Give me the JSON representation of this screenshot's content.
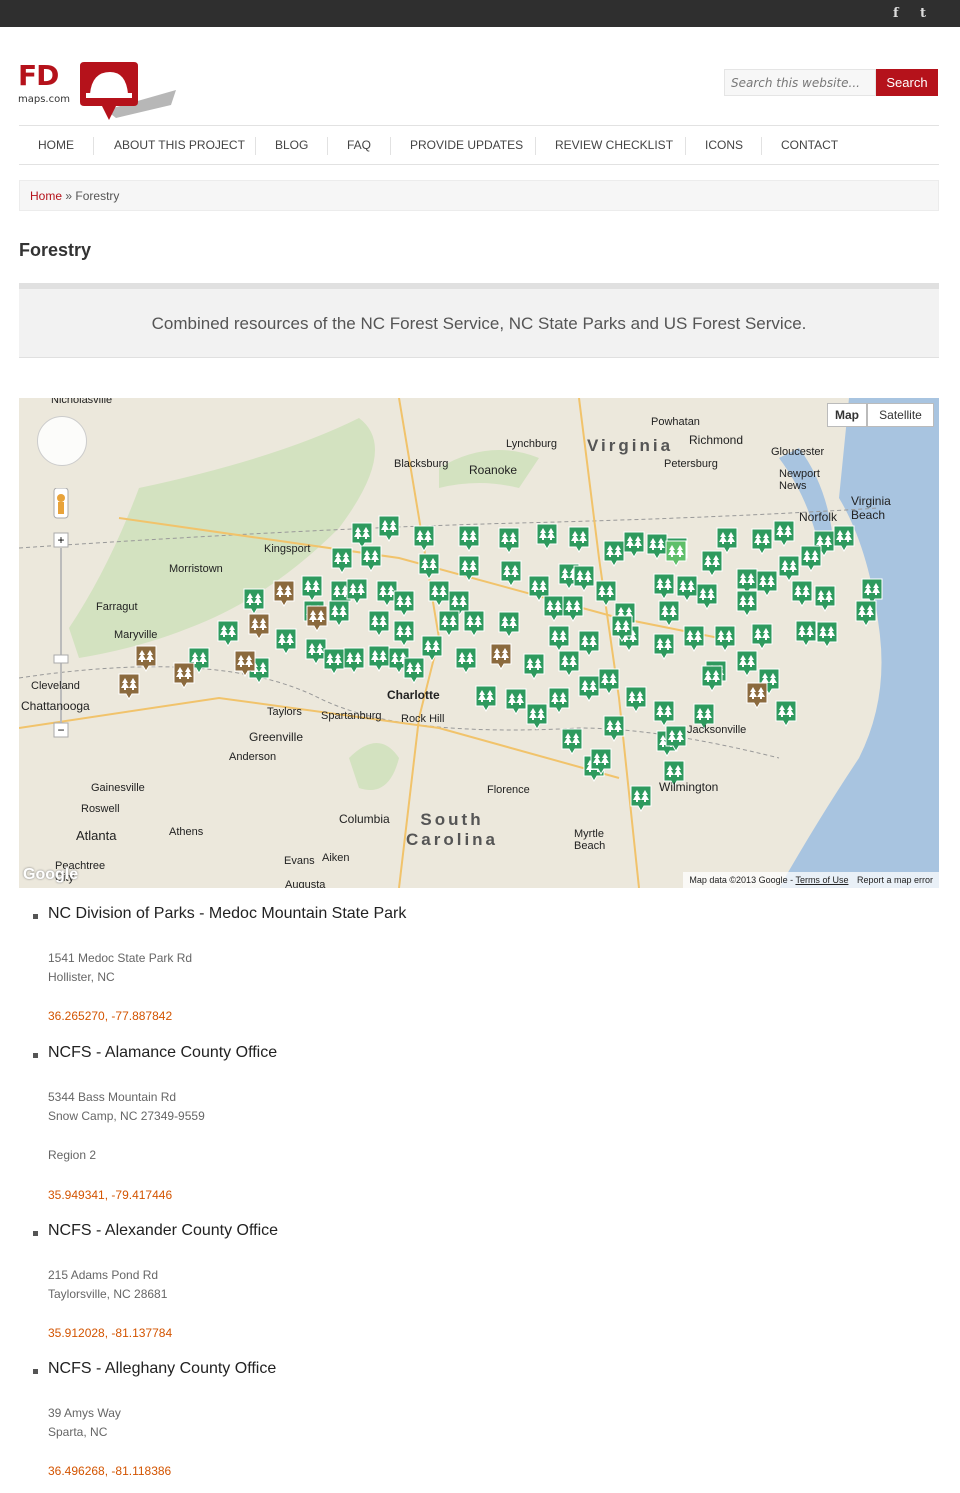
{
  "topbar": {
    "social": [
      "f",
      "t"
    ]
  },
  "logo": {
    "mark": "FD",
    "domain": "maps.com"
  },
  "search": {
    "placeholder": "Search this website...",
    "button": "Search"
  },
  "nav": {
    "items": [
      "Home",
      "About This Project",
      "Blog",
      "FAQ",
      "Provide Updates",
      "Review Checklist",
      "Icons",
      "Contact"
    ]
  },
  "breadcrumb": {
    "home": "Home",
    "separator": "»",
    "current": "Forestry"
  },
  "page": {
    "title": "Forestry",
    "intro": "Combined resources of the NC Forest Service, NC State Parks and US Forest Service."
  },
  "map": {
    "type_buttons": [
      "Map",
      "Satellite"
    ],
    "attribution": "Map data ©2013 Google",
    "terms": "Terms of Use",
    "report": "Report a map error",
    "logo": "Google",
    "labels": {
      "virginia": "Virginia",
      "south_carolina": "South Carolina",
      "richmond": "Richmond",
      "norfolk": "Norfolk",
      "virginia_beach": "Virginia Beach",
      "newport_news": "Newport News",
      "petersburg": "Petersburg",
      "lynchburg": "Lynchburg",
      "roanoke": "Roanoke",
      "blacksburg": "Blacksburg",
      "charlotte": "Charlotte",
      "kingsport": "Kingsport",
      "morristown": "Morristown",
      "farragut": "Farragut",
      "maryville": "Maryville",
      "cleveland": "Cleveland",
      "chattanooga": "Chattanooga",
      "atlanta": "Atlanta",
      "athens": "Athens",
      "greenville": "Greenville",
      "spartanburg": "Spartanburg",
      "columbia": "Columbia",
      "florence": "Florence",
      "myrtle_beach": "Myrtle Beach",
      "wilmington": "Wilmington",
      "jacksonville": "Jacksonville",
      "rock_hill": "Rock Hill",
      "anderson": "Anderson",
      "taylors": "Taylors",
      "gainesville": "Gainesville",
      "roswell": "Roswell",
      "evans": "Evans",
      "aiken": "Aiken",
      "augusta": "Augusta",
      "gloucester": "Gloucester",
      "powhatan": "Powhatan",
      "nicholasville": "Nicholasville",
      "peachtree_city": "Peachtree City"
    },
    "marker_colors": {
      "state_forest": "#2e9a5e",
      "us_forest": "#8b6a3e",
      "highlight": "#5fbf6a"
    }
  },
  "locations": [
    {
      "name": "NC Division of Parks - Medoc Mountain State Park",
      "address": [
        "1541 Medoc State Park Rd",
        "Hollister, NC"
      ],
      "coords": "36.265270, -77.887842"
    },
    {
      "name": "NCFS - Alamance County Office",
      "address": [
        "5344 Bass Mountain Rd",
        "Snow Camp, NC 27349-9559"
      ],
      "region": "Region 2",
      "coords": "35.949341, -79.417446"
    },
    {
      "name": "NCFS - Alexander County Office",
      "address": [
        "215 Adams Pond Rd",
        "Taylorsville, NC 28681"
      ],
      "coords": "35.912028, -81.137784"
    },
    {
      "name": "NCFS - Alleghany County Office",
      "address": [
        "39 Amys Way",
        "Sparta, NC"
      ],
      "coords": "36.496268, -81.118386"
    }
  ]
}
